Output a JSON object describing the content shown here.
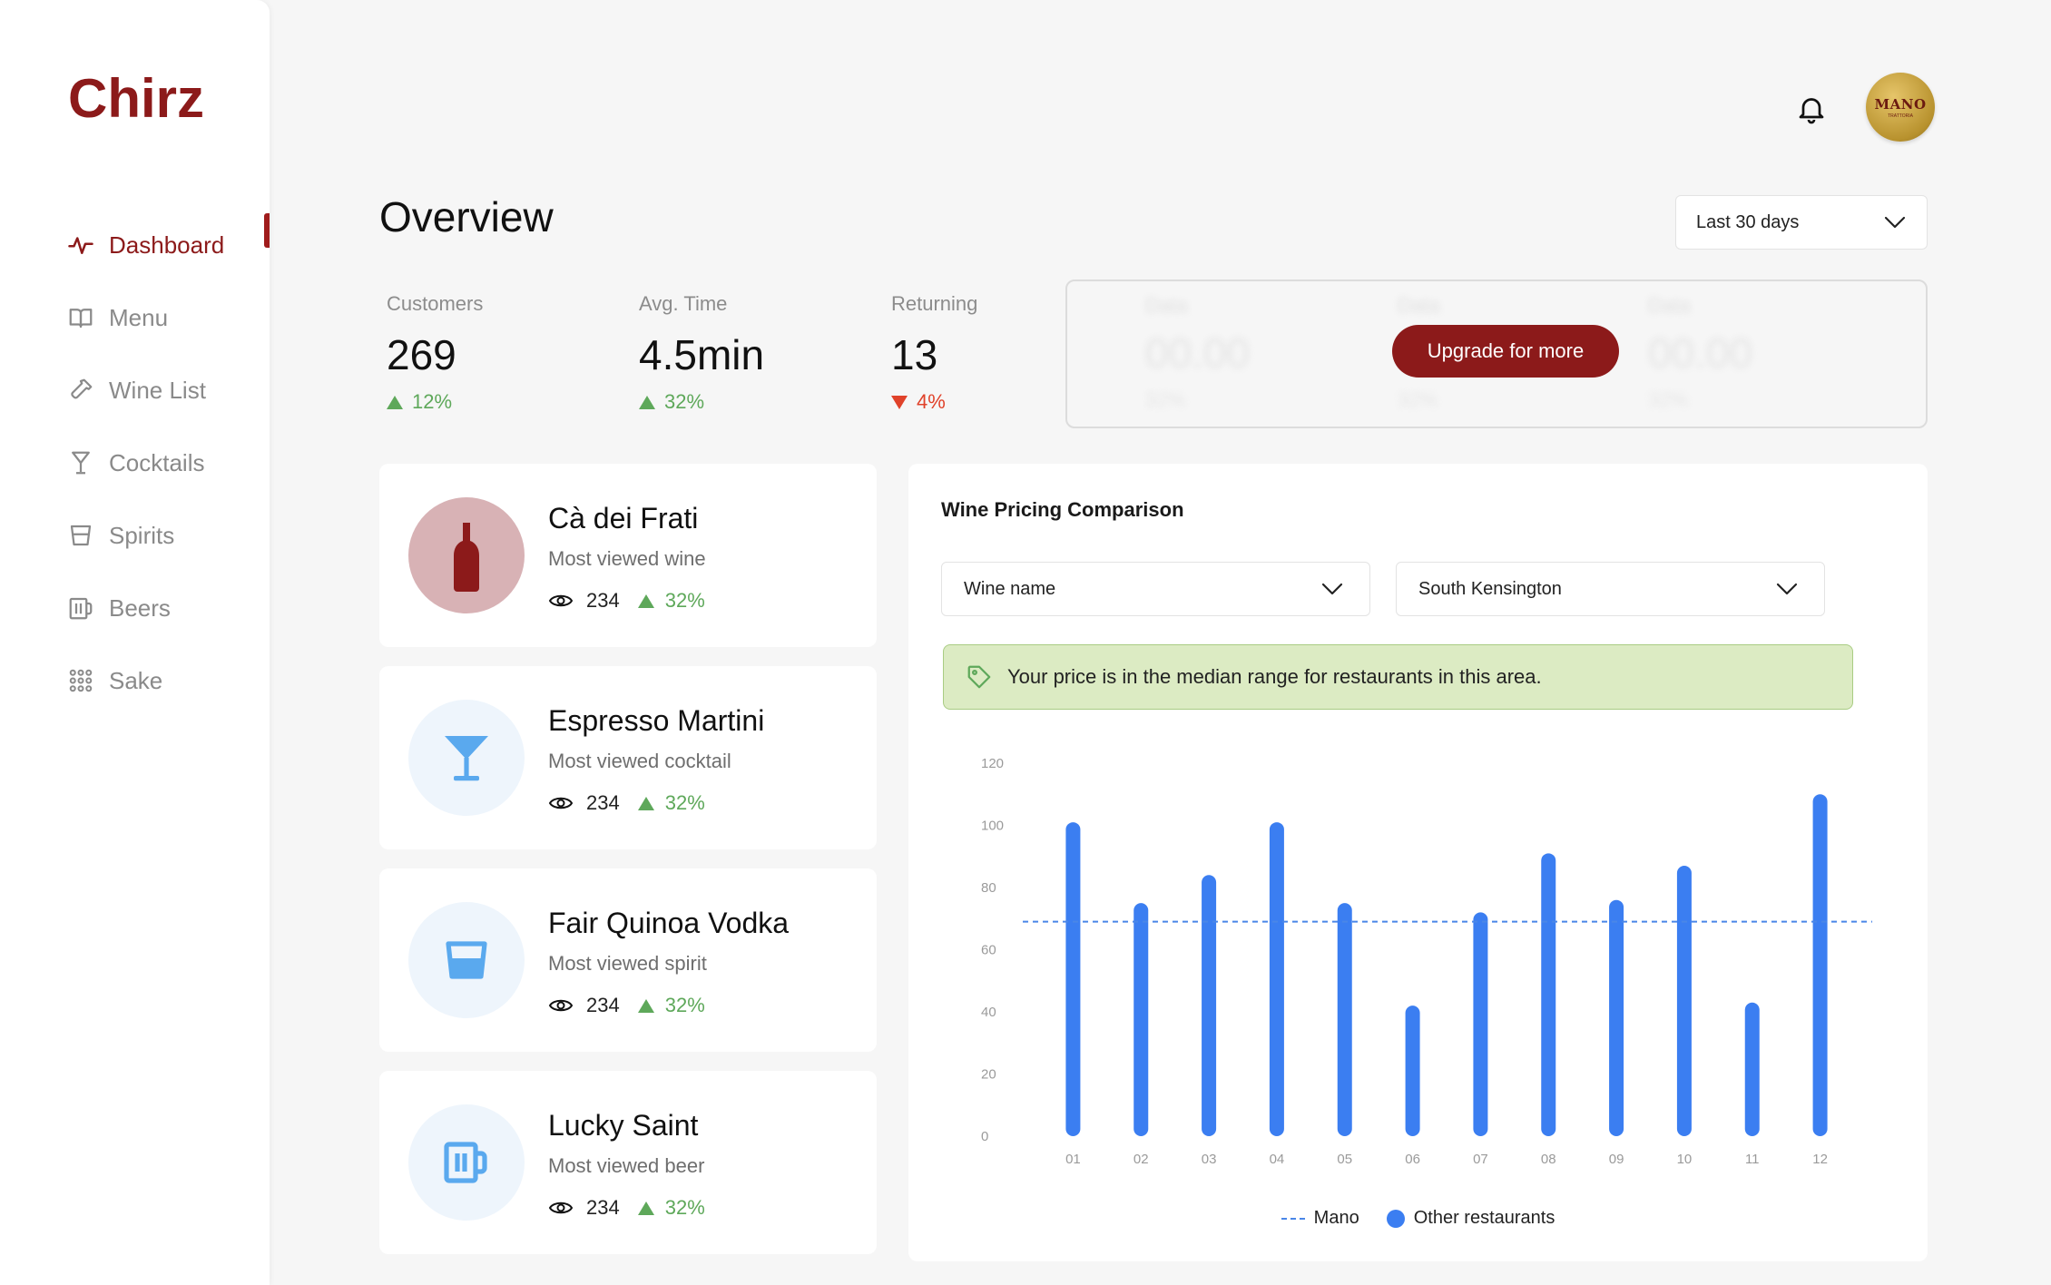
{
  "app": {
    "logo": "Chirz"
  },
  "sidebar": {
    "items": [
      {
        "label": "Dashboard",
        "icon": "activity-icon",
        "active": true
      },
      {
        "label": "Menu",
        "icon": "book-icon"
      },
      {
        "label": "Wine List",
        "icon": "wine-bottle-icon"
      },
      {
        "label": "Cocktails",
        "icon": "cocktail-glass-icon"
      },
      {
        "label": "Spirits",
        "icon": "spirit-glass-icon"
      },
      {
        "label": "Beers",
        "icon": "beer-mug-icon"
      },
      {
        "label": "Sake",
        "icon": "grid-dots-icon"
      }
    ]
  },
  "header": {
    "avatar_text": "MANO",
    "avatar_sub": "TRATTORIA"
  },
  "overview": {
    "title": "Overview",
    "range": "Last 30 days",
    "stats": [
      {
        "label": "Customers",
        "value": "269",
        "delta": "12%",
        "direction": "up"
      },
      {
        "label": "Avg. Time",
        "value": "4.5min",
        "delta": "32%",
        "direction": "up"
      },
      {
        "label": "Returning",
        "value": "13",
        "delta": "4%",
        "direction": "down"
      }
    ],
    "locked": {
      "upgrade_label": "Upgrade for more",
      "placeholder_label": "Data",
      "placeholder_value": "00.00",
      "placeholder_delta": "32%"
    }
  },
  "cards": [
    {
      "title": "Cà dei Frati",
      "subtitle": "Most viewed wine",
      "views": "234",
      "delta": "32%",
      "icon": "wine-bottle-icon",
      "bg": "#d8b2b5",
      "fg": "#8c1a1a"
    },
    {
      "title": "Espresso Martini",
      "subtitle": "Most viewed cocktail",
      "views": "234",
      "delta": "32%",
      "icon": "cocktail-glass-icon",
      "bg": "#eef5fc",
      "fg": "#5aa9ee"
    },
    {
      "title": "Fair Quinoa Vodka",
      "subtitle": "Most viewed spirit",
      "views": "234",
      "delta": "32%",
      "icon": "spirit-glass-icon",
      "bg": "#eef5fc",
      "fg": "#5aa9ee"
    },
    {
      "title": "Lucky Saint",
      "subtitle": "Most viewed beer",
      "views": "234",
      "delta": "32%",
      "icon": "beer-mug-icon",
      "bg": "#eef5fc",
      "fg": "#5aa9ee"
    }
  ],
  "pricing": {
    "title": "Wine Pricing Comparison",
    "wine_select": "Wine name",
    "area_select": "South Kensington",
    "banner": "Your price is in the median range for restaurants in this area."
  },
  "chart_data": {
    "type": "bar",
    "categories": [
      "01",
      "02",
      "03",
      "04",
      "05",
      "06",
      "07",
      "08",
      "09",
      "10",
      "11",
      "12"
    ],
    "series": [
      {
        "name": "Other restaurants",
        "values": [
          101,
          75,
          84,
          101,
          75,
          42,
          72,
          91,
          76,
          87,
          43,
          110
        ]
      },
      {
        "name": "Mano",
        "type": "line",
        "style": "dashed",
        "value": 69
      }
    ],
    "yticks": [
      "0",
      "20",
      "40",
      "60",
      "80",
      "100",
      "120"
    ],
    "ylim": [
      0,
      120
    ],
    "grid": false,
    "legend_position": "bottom-center",
    "colors": {
      "bars": "#3b7ef1",
      "reference_line": "#4a86e8"
    }
  }
}
